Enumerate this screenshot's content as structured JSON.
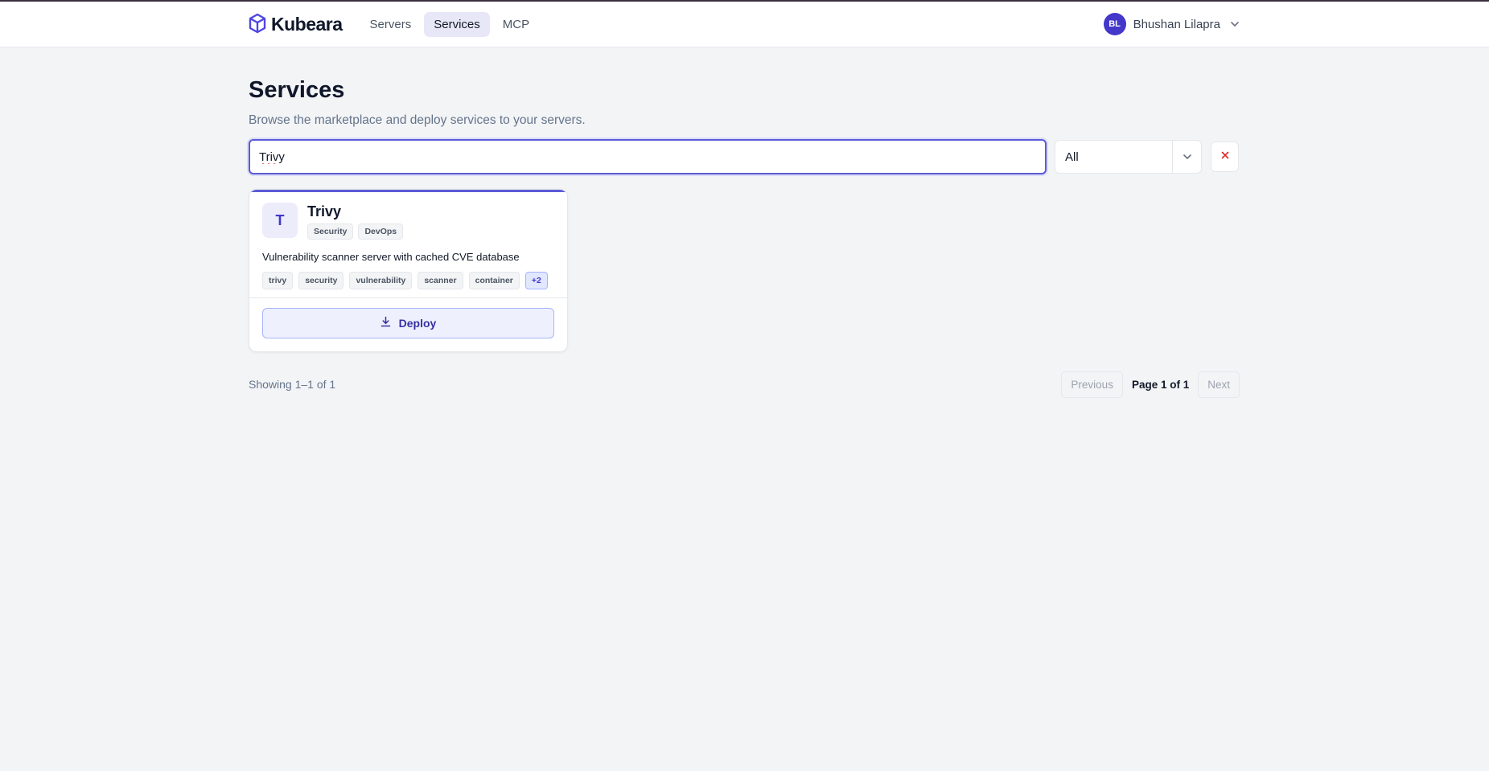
{
  "nav": {
    "brand": "Kubeara",
    "links": [
      {
        "label": "Servers",
        "active": false
      },
      {
        "label": "Services",
        "active": true
      },
      {
        "label": "MCP",
        "active": false
      }
    ],
    "user": {
      "initials": "BL",
      "name": "Bhushan Lilapra"
    }
  },
  "page": {
    "title": "Services",
    "subtitle": "Browse the marketplace and deploy services to your servers."
  },
  "filters": {
    "search_value": "Trivy",
    "category_selected": "All"
  },
  "cards": [
    {
      "logo_letter": "T",
      "title": "Trivy",
      "categories": [
        "Security",
        "DevOps"
      ],
      "description": "Vulnerability scanner server with cached CVE database",
      "tags": [
        "trivy",
        "security",
        "vulnerability",
        "scanner",
        "container"
      ],
      "more_tags": "+2",
      "deploy_label": "Deploy"
    }
  ],
  "pagination": {
    "showing": "Showing 1–1 of 1",
    "previous": "Previous",
    "page_text": "Page 1 of 1",
    "next": "Next"
  },
  "colors": {
    "accent": "#5b5bd6",
    "accent_dark": "#4338ca",
    "background": "#f3f4f6",
    "clear_red": "#dc2626"
  }
}
